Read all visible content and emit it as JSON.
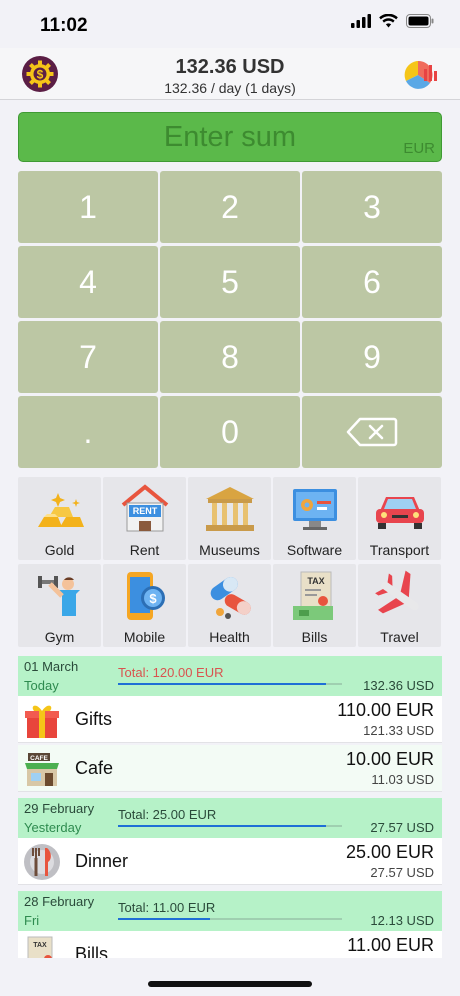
{
  "status": {
    "time": "11:02"
  },
  "header": {
    "total": "132.36 USD",
    "subtitle": "132.36 / day (1 days)",
    "settings_icon": "gear-dollar-icon",
    "stats_icon": "pie-chart-icon"
  },
  "input": {
    "placeholder": "Enter sum",
    "currency": "EUR"
  },
  "keypad": {
    "k1": "1",
    "k2": "2",
    "k3": "3",
    "k4": "4",
    "k5": "5",
    "k6": "6",
    "k7": "7",
    "k8": "8",
    "k9": "9",
    "kdot": ".",
    "k0": "0",
    "backspace_icon": "backspace-icon"
  },
  "categories": {
    "gold": "Gold",
    "rent": "Rent",
    "museums": "Museums",
    "software": "Software",
    "transport": "Transport",
    "gym": "Gym",
    "mobile": "Mobile",
    "health": "Health",
    "bills": "Bills",
    "travel": "Travel"
  },
  "groups": [
    {
      "date": "01 March",
      "day": "Today",
      "total": "Total: 120.00 EUR",
      "usd": "132.36 USD",
      "fill": 0.93,
      "total_color": "#d9534f"
    },
    {
      "date": "29 February",
      "day": "Yesterday",
      "total": "Total: 25.00 EUR",
      "usd": "27.57 USD",
      "fill": 0.93
    },
    {
      "date": "28 February",
      "day": "Fri",
      "total": "Total: 11.00 EUR",
      "usd": "12.13 USD",
      "fill": 0.41
    }
  ],
  "entries": [
    {
      "name": "Gifts",
      "amount": "110.00 EUR",
      "converted": "121.33 USD",
      "icon": "gift-icon"
    },
    {
      "name": "Cafe",
      "amount": "10.00 EUR",
      "converted": "11.03 USD",
      "icon": "cafe-icon"
    },
    {
      "name": "Dinner",
      "amount": "25.00 EUR",
      "converted": "27.57 USD",
      "icon": "dinner-icon"
    },
    {
      "name": "Bills",
      "amount": "11.00 EUR",
      "converted": "",
      "icon": "bills-icon"
    }
  ]
}
